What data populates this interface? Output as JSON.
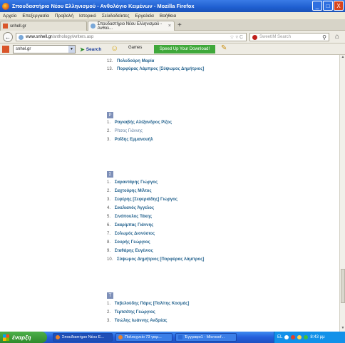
{
  "window": {
    "title": "Σπουδαστήριο Νέου Ελληνισμού - Ανθολόγιο Κειμένων - Mozilla Firefox",
    "buttons": {
      "minimize": "_",
      "maximize": "□",
      "close": "X"
    }
  },
  "menu": [
    "Αρχείο",
    "Επεξεργασία",
    "Προβολή",
    "Ιστορικό",
    "Σελιδοδείκτες",
    "Εργαλεία",
    "Βοήθεια"
  ],
  "tabs": [
    {
      "label": "snhell.gr"
    },
    {
      "label": "Σπουδαστήριο Νέου Ελληνισμού - Ανθολ...",
      "close": "×"
    }
  ],
  "tab_add": "+",
  "nav": {
    "back": "←",
    "url_host": "www.snhell.gr",
    "url_path": "/anthology/writers.asp",
    "url_right": "☆ ▿ C",
    "search_placeholder": "SweetIM Search",
    "search_icon": "magnifier-icon",
    "home_icon": "⌂"
  },
  "toolbar": {
    "select_value": "snhel.gr",
    "select_arrow": "▼",
    "search_label": "Search",
    "search_arrow": "➤",
    "face": "☺",
    "games_label": "Games",
    "download_label": "Speed Up Your Download!",
    "pen": "✎"
  },
  "content": {
    "top_items": [
      {
        "num": "12.",
        "name": "Πολυδούρη Μαρία"
      },
      {
        "num": "13.",
        "name": "Πορφύρας Λάμπρος [Σύψωμος Δημήτριος]"
      }
    ],
    "sections": [
      {
        "letter": "Ρ",
        "items": [
          {
            "num": "1.",
            "name": "Ραγκαβής Αλέξανδρος Ρίζος"
          },
          {
            "num": "2.",
            "name": "Ρίτσος Γιάννης",
            "plain": true
          },
          {
            "num": "3.",
            "name": "Ροΐδης Εμμανουήλ"
          }
        ]
      },
      {
        "letter": "Σ",
        "items": [
          {
            "num": "1.",
            "name": "Σαραντάρης Γιώργος"
          },
          {
            "num": "2.",
            "name": "Σαχτούρης Μίλτος"
          },
          {
            "num": "3.",
            "name": "Σεφέρης [Σεφεριάδης] Γιώργος"
          },
          {
            "num": "4.",
            "name": "Σικελιανός Άγγελος"
          },
          {
            "num": "5.",
            "name": "Σινόπουλος Τάκης"
          },
          {
            "num": "6.",
            "name": "Σκαρίμπας Γιάννης"
          },
          {
            "num": "7.",
            "name": "Σολωμός Διονύσιος"
          },
          {
            "num": "8.",
            "name": "Σουρής Γεώργιος"
          },
          {
            "num": "9.",
            "name": "Σταθάρης Ευγένιος"
          },
          {
            "num": "10.",
            "name": "Σύψωμος Δημήτριος [Πορφύρας Λάμπρος]"
          }
        ]
      },
      {
        "letter": "Τ",
        "items": [
          {
            "num": "1.",
            "name": "Ταβελούδης Πάρις [Πολίτης Κοσμάς]"
          },
          {
            "num": "2.",
            "name": "Τερτσέτης Γεώργιος"
          },
          {
            "num": "3.",
            "name": "Τσώλης Ιωάννης Ανδρέας"
          }
        ]
      }
    ]
  },
  "taskbar": {
    "start_label": "έναρξη",
    "tasks": [
      {
        "label": "Σπουδαστήριο Νέου Ε...",
        "color": "#e8802a"
      },
      {
        "label": "Πολιτεχνείο 73 γιορ...",
        "color": "#e8802a"
      },
      {
        "label": "Έγγραφο1 - Microsof...",
        "color": "#2a6ad8"
      }
    ],
    "tray_lang": "EL",
    "clock": "8:43 μμ"
  },
  "colors": {
    "link": "#26648f",
    "letter_badge": "#7d8fb8",
    "title_bar": "#1f5fd0",
    "taskbar": "#245edb",
    "start": "#2f8a2c"
  }
}
